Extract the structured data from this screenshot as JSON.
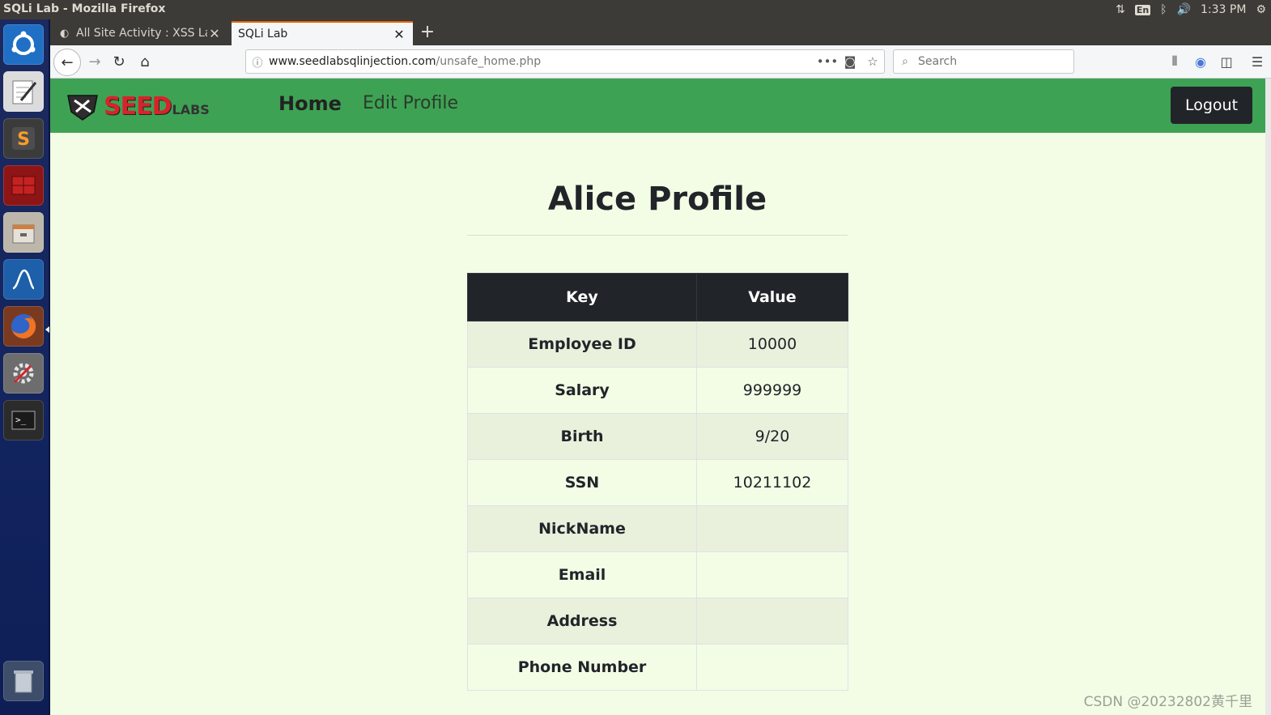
{
  "window": {
    "title": "SQLi Lab - Mozilla Firefox"
  },
  "tray": {
    "lang": "En",
    "time": "1:33 PM"
  },
  "launcher": {
    "items": [
      {
        "name": "ubuntu-dash-icon",
        "color": "#1f6fc5"
      },
      {
        "name": "text-editor-icon",
        "color": "#d9d9d9"
      },
      {
        "name": "sublime-text-icon",
        "color": "#4a4a4a"
      },
      {
        "name": "terminal-red-icon",
        "color": "#b81d1d"
      },
      {
        "name": "file-manager-icon",
        "color": "#c9c2b6"
      },
      {
        "name": "wireshark-icon",
        "color": "#1d5fa8"
      },
      {
        "name": "firefox-icon",
        "color": "#e8602c"
      },
      {
        "name": "system-settings-icon",
        "color": "#8a8a8a"
      },
      {
        "name": "terminal-icon",
        "color": "#2b2b2b"
      },
      {
        "name": "trash-icon",
        "color": "#9aa4b0"
      }
    ]
  },
  "tabs": [
    {
      "label": "All Site Activity : XSS Lab",
      "active": false
    },
    {
      "label": "SQLi Lab",
      "active": true
    }
  ],
  "navbar": {
    "url_domain": "www.seedlabsqlinjection.com",
    "url_path": "/unsafe_home.php",
    "search_placeholder": "Search"
  },
  "site": {
    "logo_text": "SEED",
    "logo_sub": "LABS",
    "nav_home": "Home",
    "nav_edit": "Edit Profile",
    "logout": "Logout"
  },
  "profile": {
    "title": "Alice Profile",
    "headers": {
      "key": "Key",
      "value": "Value"
    },
    "rows": [
      {
        "key": "Employee ID",
        "value": "10000"
      },
      {
        "key": "Salary",
        "value": "999999"
      },
      {
        "key": "Birth",
        "value": "9/20"
      },
      {
        "key": "SSN",
        "value": "10211102"
      },
      {
        "key": "NickName",
        "value": ""
      },
      {
        "key": "Email",
        "value": ""
      },
      {
        "key": "Address",
        "value": ""
      },
      {
        "key": "Phone Number",
        "value": ""
      }
    ]
  },
  "watermark": "CSDN @20232802黄千里",
  "colors": {
    "header_green": "#3ea254",
    "page_bg": "#f3fde6",
    "table_dark": "#212529",
    "logo_red": "#d8232a"
  }
}
